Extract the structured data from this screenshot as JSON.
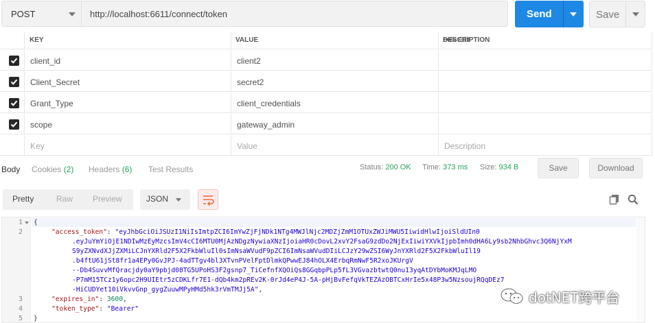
{
  "request": {
    "method": "POST",
    "url": "http://localhost:6611/connect/token",
    "send_label": "Send",
    "save_label": "Save"
  },
  "params": {
    "headers": {
      "key": "KEY",
      "value": "VALUE",
      "description": "DESCRIPTION",
      "bulk_edit": "Bulk Edit",
      "more": "•••"
    },
    "rows": [
      {
        "key": "client_id",
        "value": "client2",
        "checked": true
      },
      {
        "key": "Client_Secret",
        "value": "secret2",
        "checked": true
      },
      {
        "key": "Grant_Type",
        "value": "client_credentials",
        "checked": true
      },
      {
        "key": "scope",
        "value": "gateway_admin",
        "checked": true
      }
    ],
    "placeholder": {
      "key": "Key",
      "value": "Value",
      "description": "Description"
    }
  },
  "response": {
    "tabs": {
      "body": "Body",
      "cookies": "Cookies",
      "cookies_count": "(2)",
      "headers": "Headers",
      "headers_count": "(6)",
      "tests": "Test Results"
    },
    "status_label": "Status:",
    "status_value": "200 OK",
    "time_label": "Time:",
    "time_value": "373 ms",
    "size_label": "Size:",
    "size_value": "934 B",
    "save_label": "Save",
    "download_label": "Download"
  },
  "viewer": {
    "modes": [
      "Pretty",
      "Raw",
      "Preview"
    ],
    "format": "JSON"
  },
  "code": {
    "line_numbers": [
      "1",
      "2",
      "3",
      "4",
      "5"
    ],
    "open_brace": "{",
    "access_token_key": "\"access_token\"",
    "access_token_lines": [
      "\"eyJhbGciOiJSUzI1NiIsImtpZCI6ImYwZjFjNDk1NTg4MWJlNjc2MDZjZmM1OTUxZWJiMWU5IiwidHlwIjoiSldUIn0",
      ".eyJuYmYiOjE1NDIwMzEyMzcsImV4cCI6MTU0MjAzNDgzNywiaXNzIjoiaHR0cDovL2xvY2FsaG9zdDo2NjExIiwiYXVkIjpbImh0dHA6Ly9sb2NhbGhvc3Q6NjYxM",
      "S9yZXNvdXJjZXMiLCJnYXRld2F5X2FkbWluIl0sImNsaWVudF9pZCI6ImNsaWVudDIiLCJzY29wZSI6WyJnYXRld2F5X2FkbWluIl19",
      ".b4ftU61jSt8fr1a4EPy0GvJPJ-4adTTgv4bl3XTvnPVelFptDlmkQPwwEJ84hOLX4ErbqRmNwF5R2xoJKUrgV",
      "--Db4SuvvMfQracjdy0aY9pbjd08TG5UPoHS3F2gsnp7_TiCefnfXQOiQs8GGqbpPLp5fL3VGvazbtwtQ0nu13yqAtDYbMoKMJqLMO",
      "-P7mM15TCz1y6opc2H9UIEtr5zCDKLfr7E1-dQb4km2pREv2K-0rJd4eP4J-5A-pHjBvFefqVkTEZAzOBTCxHrIe5x48P3w5NzsoujRQqDEz7",
      "-HiCUDYet10iVkvvGnp_gygZuuwMPyHMd5hk3rVmTMJj5A\""
    ],
    "expires_in_key": "\"expires_in\"",
    "expires_in_value": "3600",
    "token_type_key": "\"token_type\"",
    "token_type_value": "\"Bearer\"",
    "close_brace": "}"
  },
  "watermark": {
    "text": "dotNET跨平台"
  },
  "colors": {
    "accent": "#1e88e5",
    "status_ok": "#26a35a",
    "bulk_edit": "#f26b3a"
  }
}
